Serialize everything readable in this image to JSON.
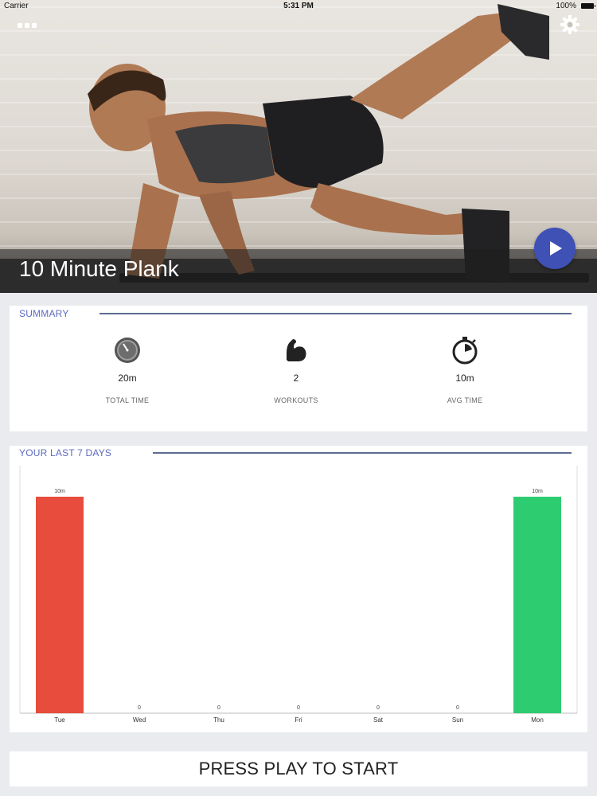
{
  "status_bar": {
    "carrier": "Carrier",
    "time": "5:31 PM",
    "battery": "100%"
  },
  "hero": {
    "title": "10 Minute Plank"
  },
  "icons": {
    "menu": "more-dots-icon",
    "settings": "gear-icon",
    "play": "play-icon",
    "stopwatch": "stopwatch-icon",
    "muscle": "flexed-bicep-icon",
    "timer": "timer-icon"
  },
  "summary": {
    "header": "SUMMARY",
    "stats": [
      {
        "value": "20m",
        "label": "TOTAL TIME"
      },
      {
        "value": "2",
        "label": "WORKOUTS"
      },
      {
        "value": "10m",
        "label": "AVG TIME"
      }
    ]
  },
  "last7": {
    "header": "YOUR LAST 7 DAYS"
  },
  "chart_data": {
    "type": "bar",
    "categories": [
      "Tue",
      "Wed",
      "Thu",
      "Fri",
      "Sat",
      "Sun",
      "Mon"
    ],
    "values": [
      10,
      0,
      0,
      0,
      0,
      0,
      10
    ],
    "value_labels": [
      "10m",
      "0",
      "0",
      "0",
      "0",
      "0",
      "10m"
    ],
    "colors": [
      "#e74c3c",
      "#e74c3c",
      "#e74c3c",
      "#e74c3c",
      "#e74c3c",
      "#e74c3c",
      "#2ecc71"
    ],
    "ylim": [
      0,
      10
    ],
    "grid": false,
    "xlabel": "",
    "ylabel": ""
  },
  "colors": {
    "accent": "#3f51b5",
    "header_text": "#5c6bc0",
    "bar_past": "#e74c3c",
    "bar_today": "#2ecc71"
  },
  "footer": {
    "start_label": "PRESS PLAY TO START"
  }
}
